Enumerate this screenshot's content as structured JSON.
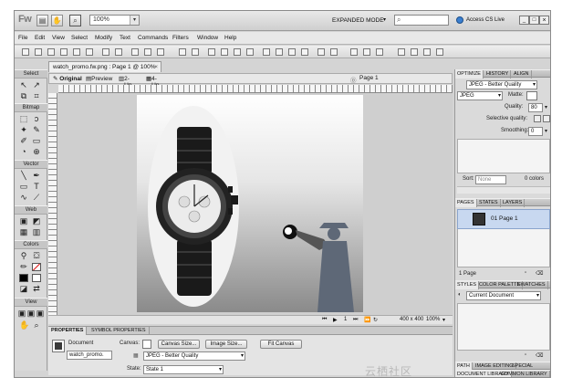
{
  "app": {
    "logo": "Fw",
    "zoom": "100%",
    "mode": "EXPANDED MODE",
    "search_placeholder": "",
    "cs_live": "Access CS Live"
  },
  "window_controls": [
    "_",
    "□",
    "×"
  ],
  "menu": [
    "File",
    "Edit",
    "View",
    "Select",
    "Modify",
    "Text",
    "Commands",
    "Filters",
    "Window",
    "Help"
  ],
  "document": {
    "tab_title": "watch_promo.fw.png : Page 1 @ 100%",
    "close": "×"
  },
  "view_tabs": [
    "Original",
    "Preview",
    "2-Up",
    "4-Up"
  ],
  "page_selector": "Page 1",
  "tools": {
    "sections": [
      "Select",
      "Bitmap",
      "Vector",
      "Web",
      "Colors",
      "View"
    ]
  },
  "status": {
    "page": "1",
    "size": "400 x 400",
    "zoom": "100%"
  },
  "properties": {
    "tabs": [
      "PROPERTIES",
      "SYMBOL PROPERTIES"
    ],
    "doc_label": "Document",
    "doc_name": "watch_promo.",
    "canvas_label": "Canvas:",
    "canvas_size_btn": "Canvas Size...",
    "image_size_btn": "Image Size...",
    "fit_canvas_btn": "Fit Canvas",
    "optimize_value": "JPEG - Better Quality",
    "state_label": "State:",
    "state_value": "State 1"
  },
  "optimize_panel": {
    "tabs": [
      "OPTIMIZE",
      "HISTORY",
      "ALIGN"
    ],
    "preset": "JPEG - Better Quality",
    "format": "JPEG",
    "matte_label": "Matte:",
    "quality_label": "Quality:",
    "quality_value": "80",
    "selective_label": "Selective quality:",
    "smoothing_label": "Smoothing:",
    "smoothing_value": "0",
    "sort_label": "Sort:",
    "sort_value": "None",
    "colors_count": "0 colors"
  },
  "pages_panel": {
    "tabs": [
      "PAGES",
      "STATES",
      "LAYERS"
    ],
    "page_item": "01 Page 1",
    "footer": "1 Page"
  },
  "styles_panel": {
    "tabs": [
      "STYLES",
      "COLOR PALETTE",
      "SWATCHES"
    ],
    "selected": "Current Document"
  },
  "bottom_panel": {
    "tabs": [
      "PATH",
      "IMAGE EDITING",
      "SPECIAL CHARS"
    ],
    "tabs2": [
      "DOCUMENT LIBRARY",
      "COMMON LIBRARY"
    ]
  },
  "watermark": "云栖社区"
}
